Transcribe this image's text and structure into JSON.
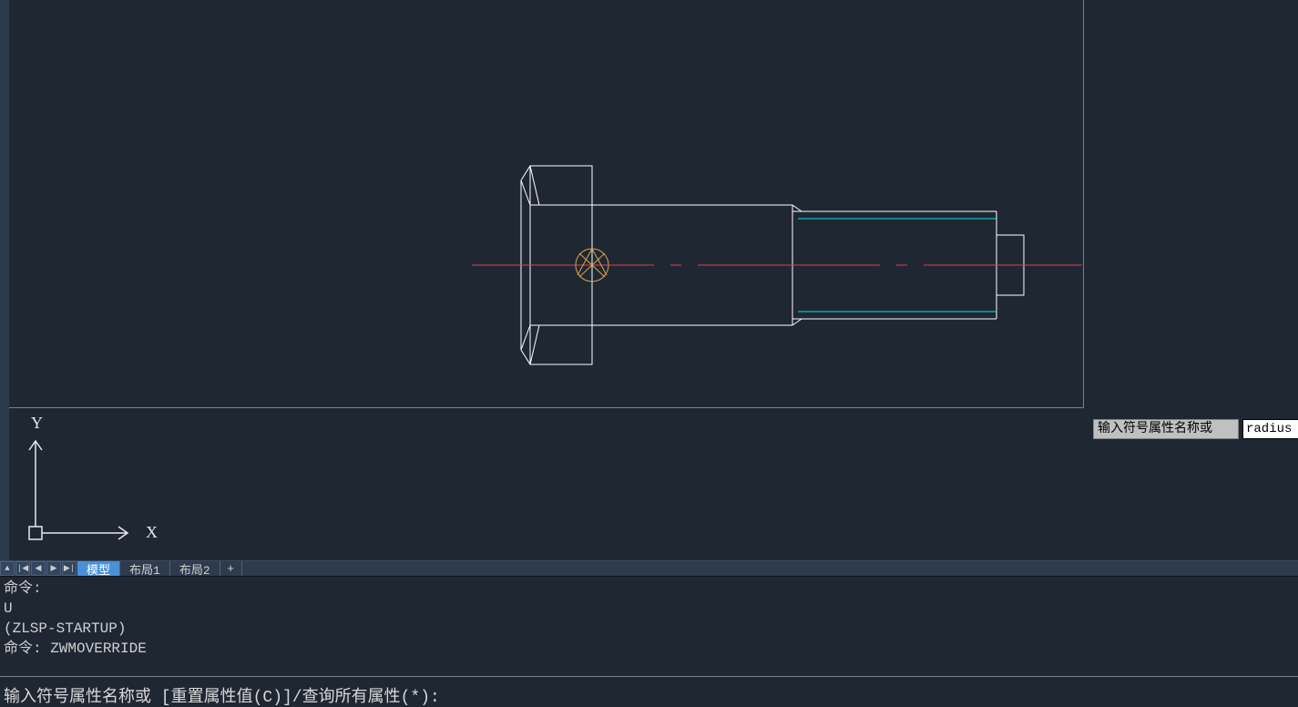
{
  "tabs": {
    "model": "模型",
    "layout1": "布局1",
    "layout2": "布局2",
    "add": "+"
  },
  "floating_prompt": {
    "label": "输入符号属性名称或",
    "input_value": "radius"
  },
  "command_history": {
    "line1": "命令:",
    "line2": "U",
    "line3": "(ZLSP-STARTUP)",
    "line4": "命令: ZWMOVERRIDE"
  },
  "command_input": {
    "text": "输入符号属性名称或 [重置属性值(C)]/查询所有属性(*):"
  },
  "ucs": {
    "x_label": "X",
    "y_label": "Y"
  }
}
